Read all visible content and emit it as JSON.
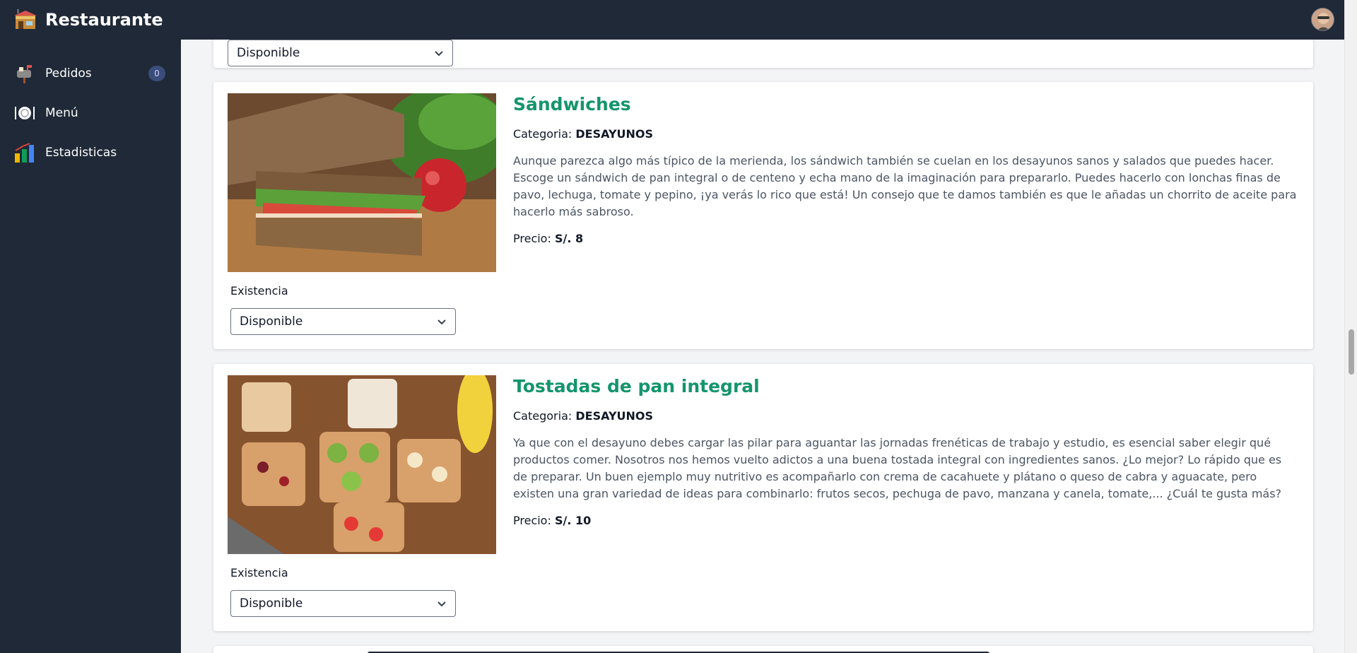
{
  "app": {
    "title": "Restaurante"
  },
  "sidebar": {
    "items": [
      {
        "label": "Pedidos",
        "icon": "mailbox-icon",
        "badge": "0"
      },
      {
        "label": "Menú",
        "icon": "dining-icon"
      },
      {
        "label": "Estadisticas",
        "icon": "bar-chart-icon"
      }
    ]
  },
  "top_select": {
    "value": "Disponible"
  },
  "products": [
    {
      "title": "Sándwiches",
      "category_label": "Categoria:",
      "category": "DESAYUNOS",
      "description": "Aunque parezca algo más típico de la merienda, los sándwich también se cuelan en los desayunos sanos y salados que puedes hacer. Escoge un sándwich de pan integral o de centeno y echa mano de la imaginación para prepararlo. Puedes hacerlo con lonchas finas de pavo, lechuga, tomate y pepino, ¡ya verás lo rico que está! Un consejo que te damos también es que le añadas un chorrito de aceite para hacerlo más sabroso.",
      "price_label": "Precio:",
      "price": "S/. 8",
      "existence_label": "Existencia",
      "existence_value": "Disponible"
    },
    {
      "title": "Tostadas de pan integral",
      "category_label": "Categoria:",
      "category": "DESAYUNOS",
      "description": "Ya que con el desayuno debes cargar las pilar para aguantar las jornadas frenéticas de trabajo y estudio, es esencial saber elegir qué productos comer. Nosotros nos hemos vuelto adictos a una buena tostada integral con ingredientes sanos. ¿Lo mejor? Lo rápido que es de preparar. Un buen ejemplo muy nutritivo es acompañarlo con crema de cacahuete y plátano o queso de cabra y aguacate, pero existen una gran variedad de ideas para combinarlo: frutos secos, pechuga de pavo, manzana y canela, tomate,... ¿Cuál te gusta más?",
      "price_label": "Precio:",
      "price": "S/. 10",
      "existence_label": "Existencia",
      "existence_value": "Disponible"
    }
  ],
  "colors": {
    "sidebar_bg": "#1f2937",
    "title_green": "#15956b",
    "badge_bg": "#3b4d7a"
  }
}
